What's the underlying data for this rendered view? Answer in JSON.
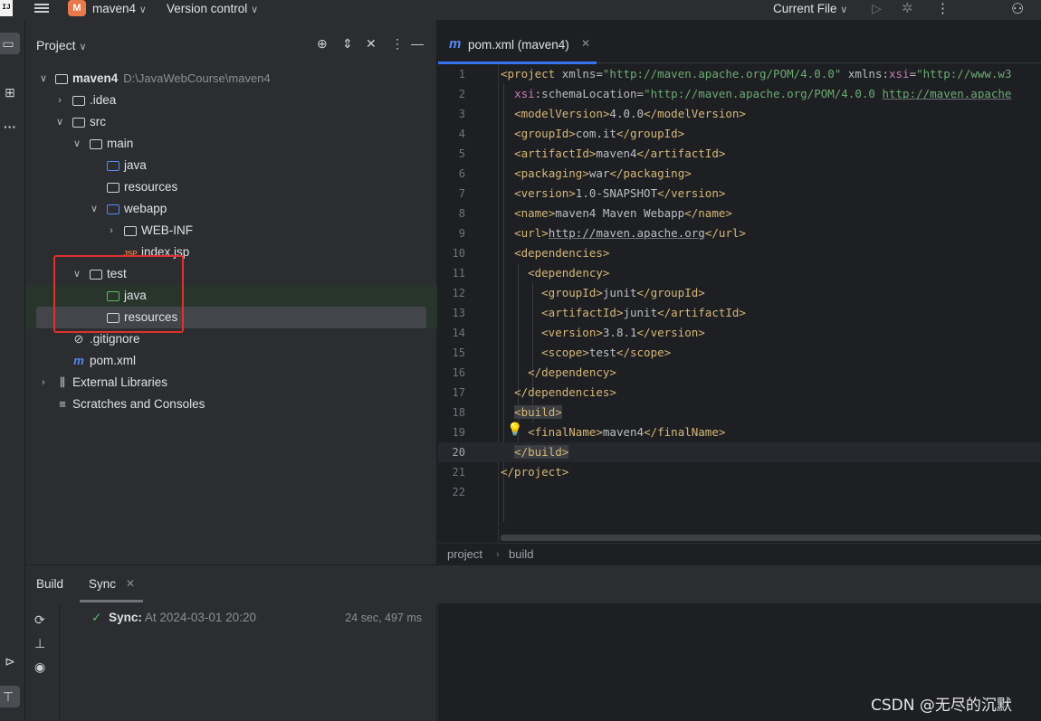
{
  "titlebar": {
    "app_logo": "IJ",
    "project_badge": "M",
    "project_name": "maven4",
    "vcs_label": "Version control",
    "run_config": "Current File",
    "chevron": "⌄"
  },
  "project_panel": {
    "title": "Project",
    "tree": {
      "root_name": "maven4",
      "root_path": "D:\\JavaWebCourse\\maven4",
      "idea": ".idea",
      "src": "src",
      "main": "main",
      "main_java": "java",
      "main_resources": "resources",
      "webapp": "webapp",
      "webinf": "WEB-INF",
      "indexjsp": "index.jsp",
      "test": "test",
      "test_java": "java",
      "test_resources": "resources",
      "gitignore": ".gitignore",
      "pom": "pom.xml",
      "ext_libs": "External Libraries",
      "scratches": "Scratches and Consoles"
    }
  },
  "editor": {
    "tab_label": "pom.xml (maven4)",
    "lines": [
      "1",
      "2",
      "3",
      "4",
      "5",
      "6",
      "7",
      "8",
      "9",
      "10",
      "11",
      "12",
      "13",
      "14",
      "15",
      "16",
      "17",
      "18",
      "19",
      "20",
      "21",
      "22"
    ],
    "current_line": "20",
    "code": {
      "l1_tag": "<project",
      "l1_a1": " xmlns=",
      "l1_v1": "\"http://maven.apache.org/POM/4.0.0\"",
      "l1_a2": " xmlns:",
      "l1_ns": "xsi",
      "l1_a3": "=",
      "l1_v2": "\"http://www.w3",
      "l2_ns": "xsi",
      "l2_a": ":schemaLocation=",
      "l2_v1": "\"http://maven.apache.org/POM/4.0.0 ",
      "l2_v2": "http://maven.apache",
      "l3": [
        "<modelVersion>",
        "4.0.0",
        "</modelVersion>"
      ],
      "l4": [
        "<groupId>",
        "com.it",
        "</groupId>"
      ],
      "l5": [
        "<artifactId>",
        "maven4",
        "</artifactId>"
      ],
      "l6": [
        "<packaging>",
        "war",
        "</packaging>"
      ],
      "l7": [
        "<version>",
        "1.0-SNAPSHOT",
        "</version>"
      ],
      "l8": [
        "<name>",
        "maven4 Maven Webapp",
        "</name>"
      ],
      "l9": [
        "<url>",
        "http://maven.apache.org",
        "</url>"
      ],
      "l10": "<dependencies>",
      "l11": "<dependency>",
      "l12": [
        "<groupId>",
        "junit",
        "</groupId>"
      ],
      "l13": [
        "<artifactId>",
        "junit",
        "</artifactId>"
      ],
      "l14": [
        "<version>",
        "3.8.1",
        "</version>"
      ],
      "l15": [
        "<scope>",
        "test",
        "</scope>"
      ],
      "l16": "</dependency>",
      "l17": "</dependencies>",
      "l18": "<build>",
      "l19": [
        "<finalName>",
        "maven4",
        "</finalName>"
      ],
      "l20": "</build>",
      "l21": "</project>"
    },
    "breadcrumb": [
      "project",
      "build"
    ]
  },
  "build_panel": {
    "tab_build": "Build",
    "tab_sync": "Sync",
    "sync_label": "Sync:",
    "sync_time": "At 2024-03-01 20:20",
    "sync_duration": "24 sec, 497 ms"
  },
  "watermark": "CSDN @无尽的沉默",
  "colors": {
    "accent": "#3574f0",
    "highlight_box": "#e0312d",
    "tag": "#d5b778",
    "string": "#6aab73"
  }
}
